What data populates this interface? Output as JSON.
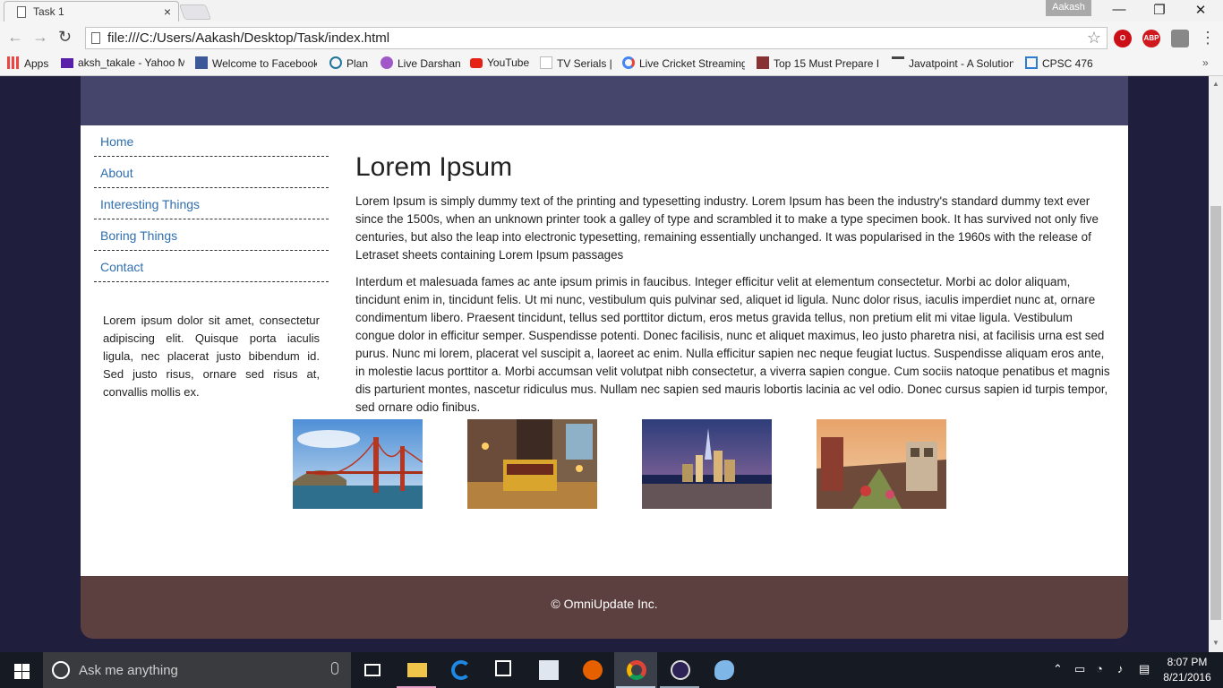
{
  "browser": {
    "tab_title": "Task 1",
    "tab_close": "×",
    "profile_name": "Aakash",
    "url": "file:///C:/Users/Aakash/Desktop/Task/index.html",
    "window_minimize": "—",
    "window_maximize": "❐",
    "window_close": "✕",
    "bookmarks": [
      {
        "label": "Apps",
        "icon": "apps-grid-icon",
        "color": "#e44"
      },
      {
        "label": "aksh_takale - Yahoo M",
        "icon": "yahoo-mail-icon",
        "color": "#5a1fa8"
      },
      {
        "label": "Welcome to Facebook",
        "icon": "facebook-icon",
        "color": "#3b5998"
      },
      {
        "label": "Plan",
        "icon": "wordpress-icon",
        "color": "#21759b"
      },
      {
        "label": "Live Darshan",
        "icon": "temple-icon",
        "color": "#a058c8"
      },
      {
        "label": "YouTube",
        "icon": "youtube-icon",
        "color": "#e62117"
      },
      {
        "label": "TV Serials |",
        "icon": "page-icon",
        "color": "#dddddd"
      },
      {
        "label": "Live Cricket Streaming",
        "icon": "google-icon",
        "color": "#4285f4"
      },
      {
        "label": "Top 15 Must Prepare I",
        "icon": "music-icon",
        "color": "#883333"
      },
      {
        "label": "Javatpoint - A Solution",
        "icon": "t-icon",
        "color": "#444444"
      },
      {
        "label": "CPSC 476",
        "icon": "window-icon",
        "color": "#2d7dd2"
      }
    ]
  },
  "page": {
    "nav": [
      "Home",
      "About",
      "Interesting Things",
      "Boring Things",
      "Contact"
    ],
    "sidebar_text": "Lorem ipsum dolor sit amet, consectetur adipiscing elit. Quisque porta iaculis ligula, nec placerat justo bibendum id. Sed justo risus, ornare sed risus at, convallis mollis ex.",
    "heading": "Lorem Ipsum",
    "paragraph1": "Lorem Ipsum is simply dummy text of the printing and typesetting industry. Lorem Ipsum has been the industry's standard dummy text ever since the 1500s, when an unknown printer took a galley of type and scrambled it to make a type specimen book. It has survived not only five centuries, but also the leap into electronic typesetting, remaining essentially unchanged. It was popularised in the 1960s with the release of Letraset sheets containing Lorem Ipsum passages",
    "paragraph2": "Interdum et malesuada fames ac ante ipsum primis in faucibus. Integer efficitur velit at elementum consectetur. Morbi ac dolor aliquam, tincidunt enim in, tincidunt felis. Ut mi nunc, vestibulum quis pulvinar sed, aliquet id ligula. Nunc dolor risus, iaculis imperdiet nunc at, ornare condimentum libero. Praesent tincidunt, tellus sed porttitor dictum, eros metus gravida tellus, non pretium elit mi vitae ligula. Vestibulum congue dolor in efficitur semper. Suspendisse potenti. Donec facilisis, nunc et aliquet maximus, leo justo pharetra nisi, at facilisis urna est sed purus. Nunc mi lorem, placerat vel suscipit a, laoreet ac enim. Nulla efficitur sapien nec neque feugiat luctus. Suspendisse aliquam eros ante, in molestie lacus porttitor a. Morbi accumsan velit volutpat nibh consectetur, a viverra sapien congue. Cum sociis natoque penatibus et magnis dis parturient montes, nascetur ridiculus mus. Nullam nec sapien sed mauris lobortis lacinia ac vel odio. Donec cursus sapien id turpis tempor, sed ornare odio finibus.",
    "footer": "© OmniUpdate Inc.",
    "colors": {
      "header": "#45456b",
      "footer": "#5c3f3f",
      "link": "#2f6fb0",
      "background": "#1f1f3d"
    }
  },
  "taskbar": {
    "search_placeholder": "Ask me anything",
    "time": "8:07 PM",
    "date": "8/21/2016"
  }
}
